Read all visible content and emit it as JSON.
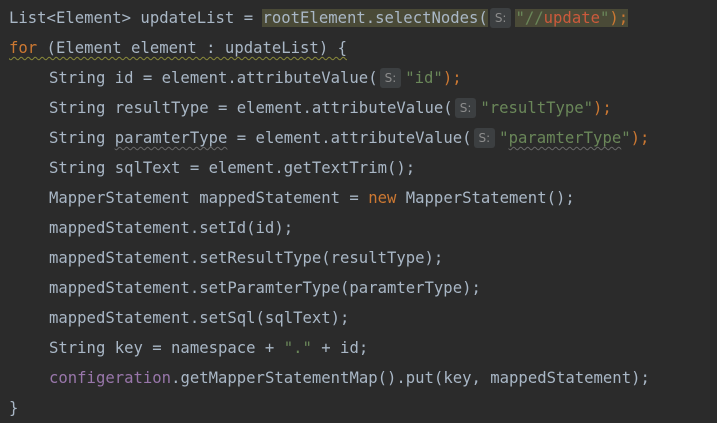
{
  "editor": {
    "hint_label": "S:",
    "lines": [
      {
        "l1_a": "List<Element> updateList = ",
        "l1_b": "rootElement.selectNodes(",
        "l1_c": "\"//",
        "l1_d": "update",
        "l1_e": "\"",
        "l1_f": ");"
      },
      {
        "l2_kw": "for",
        "l2_a": " (Element element : updateList) {"
      },
      {
        "l3_a": "String id = element.attributeValue(",
        "l3_s": "\"id\"",
        "l3_b": ");"
      },
      {
        "l4_a": "String resultType = element.attributeValue(",
        "l4_s": "\"resultType\"",
        "l4_b": ");"
      },
      {
        "l5_a": "String ",
        "l5_v": "paramterType",
        "l5_b": " = element.attributeValue(",
        "l5_s1": "\"",
        "l5_s2": "paramterType",
        "l5_s3": "\"",
        "l5_c": ");"
      },
      {
        "l6_a": "String sqlText = element.getTextTrim();"
      },
      {
        "l7_a": "MapperStatement mappedStatement = ",
        "l7_kw": "new",
        "l7_b": " MapperStatement();"
      },
      {
        "l8_a": "mappedStatement.setId(id);"
      },
      {
        "l9_a": "mappedStatement.setResultType(resultType);"
      },
      {
        "l10_a": "mappedStatement.setParamterType(paramterType);"
      },
      {
        "l11_a": "mappedStatement.setSql(sqlText);"
      },
      {
        "l12_a": "String key = namespace + ",
        "l12_s": "\".\"",
        "l12_b": " + id;"
      },
      {
        "l13_f": "configeration",
        "l13_a": ".getMapperStatementMap().put(key, mappedStatement);"
      },
      {
        "l14_a": "}"
      }
    ]
  },
  "colors": {
    "background": "#2b2b2b",
    "text": "#a9b7c6",
    "keyword": "#cc7832",
    "string": "#6a8759",
    "field": "#9876aa",
    "highlight": "#3b3a2f"
  }
}
